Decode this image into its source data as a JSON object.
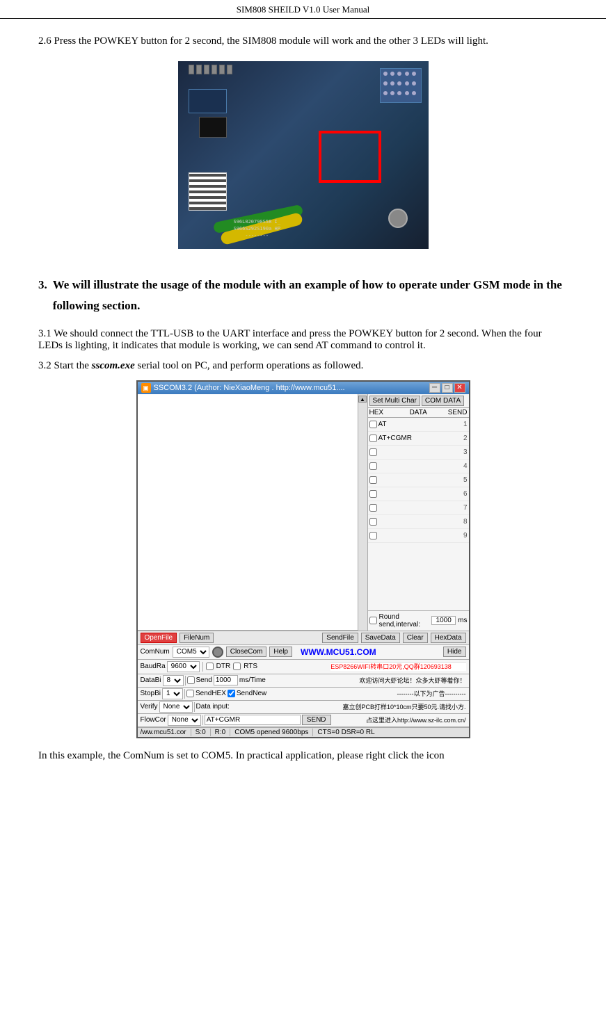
{
  "header": {
    "title": "SIM808 SHEILD V1.0 User Manual"
  },
  "section_26": {
    "text": "2.6 Press the POWKEY button for 2 second, the SIM808 module will work and the other 3 LEDs will light."
  },
  "section_3": {
    "heading_num": "3.",
    "heading_text": "We will illustrate the usage of the module with an example of how to operate under GSM mode in the following section."
  },
  "section_31": {
    "label": "3.1",
    "text": "We should connect the TTL-USB to the UART interface and press the POWKEY button for 2 second. When the four LEDs is lighting, it indicates that module is working, we can send AT command to control it."
  },
  "section_32": {
    "label": "3.2",
    "text_prefix": "Start the ",
    "bold_text": "sscom.exe",
    "text_suffix": " serial tool on PC, and perform operations as followed."
  },
  "sscom": {
    "titlebar": "SSCOM3.2 (Author: NieXiaoMeng . http://www.mcu51....",
    "tab_set_multi_char": "Set Multi Char",
    "tab_com_data": "COM DATA",
    "col_hex": "HEX",
    "col_data": "DATA",
    "col_send": "SEND",
    "rows": [
      {
        "check": false,
        "data": "AT",
        "num": "1"
      },
      {
        "check": false,
        "data": "AT+CGMR",
        "num": "2"
      },
      {
        "check": false,
        "data": "",
        "num": "3"
      },
      {
        "check": false,
        "data": "",
        "num": "4"
      },
      {
        "check": false,
        "data": "",
        "num": "5"
      },
      {
        "check": false,
        "data": "",
        "num": "6"
      },
      {
        "check": false,
        "data": "",
        "num": "7"
      },
      {
        "check": false,
        "data": "",
        "num": "8"
      },
      {
        "check": false,
        "data": "",
        "num": "9"
      }
    ],
    "round_send_label": "Round send,interval:",
    "round_send_value": "1000",
    "round_send_unit": "ms",
    "toolbar_open_file": "OpenFile",
    "toolbar_file_num": "FileNum",
    "toolbar_send_file": "SendFile",
    "toolbar_save_data": "SaveData",
    "toolbar_clear": "Clear",
    "toolbar_hex_data": "HexData",
    "mcu_link": "WWW.MCU51.COM",
    "toolbar_hide": "Hide",
    "com_num_label": "ComNum",
    "com_num_value": "COM5",
    "close_com": "CloseCom",
    "help": "Help",
    "baud_rate_label": "BaudRa",
    "baud_rate_value": "9600",
    "data_bits_label": "DataBi",
    "data_bits_value": "8",
    "stop_bits_label": "StopBi",
    "stop_bits_value": "1",
    "verify_label": "Verify",
    "verify_value": "None",
    "flow_ctrl_label": "FlowCor",
    "flow_ctrl_value": "None",
    "dtr_label": "DTR",
    "rts_label": "RTS",
    "send_label": "Send",
    "sendnew_label": "SendNew",
    "sendhex_label": "SendHEX",
    "ms_time": "ms/Time",
    "data_input_label": "Data input:",
    "data_input_value": "AT+CGMR",
    "send_btn": "SEND",
    "advert_line1": "ESP8266WIFI转串口20元,QQ群120693138",
    "advert_line2": "欢迎访问大虾论坛！众多大虾等着你！",
    "advert_line3": "--------以下为广告----------",
    "advert_line4": "嘉立创PCB打样10*10cm只要50元.请找小方.",
    "advert_line5": "占这里进入http://www.sz-ilc.com.cn/",
    "status_url": "/ww.mcu51.cor",
    "status_s": "S:0",
    "status_r": "R:0",
    "status_com": "COM5 opened 9600bps",
    "status_cts": "CTS=0 DSR=0 RL",
    "ms_value": "1000"
  },
  "bottom_text": "In this example, the ComNum is set to COM5. In practical application, please right click the icon"
}
